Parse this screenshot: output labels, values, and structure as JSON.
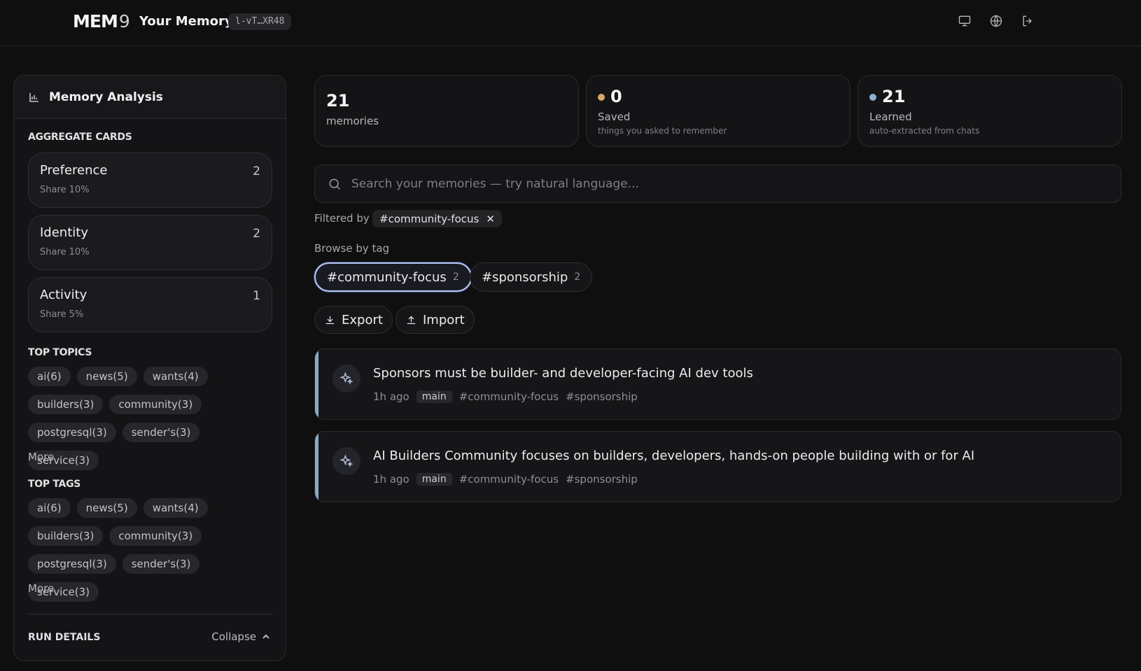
{
  "header": {
    "brand": "MEM",
    "brand_suffix": "9",
    "title": "Your Memory",
    "key": "l-vT…XR48",
    "icons": [
      "monitor-icon",
      "globe-icon",
      "logout-icon"
    ]
  },
  "sidebar": {
    "title": "Memory Analysis",
    "aggregate_label": "AGGREGATE CARDS",
    "aggregate_cards": [
      {
        "name": "Preference",
        "count": "2",
        "share": "Share 10%"
      },
      {
        "name": "Identity",
        "count": "2",
        "share": "Share 10%"
      },
      {
        "name": "Activity",
        "count": "1",
        "share": "Share 5%"
      }
    ],
    "topics_label": "TOP TOPICS",
    "topics": [
      "ai(6)",
      "news(5)",
      "wants(4)",
      "builders(3)",
      "community(3)",
      "postgresql(3)",
      "sender's(3)",
      "service(3)"
    ],
    "topics_more": "More",
    "tags_label": "TOP TAGS",
    "tags": [
      "ai(6)",
      "news(5)",
      "wants(4)",
      "builders(3)",
      "community(3)",
      "postgresql(3)",
      "sender's(3)",
      "service(3)"
    ],
    "tags_more": "More",
    "run_details_label": "RUN DETAILS",
    "collapse_label": "Collapse"
  },
  "stats": [
    {
      "num": "21",
      "label": "memories",
      "sub": ""
    },
    {
      "num": "0",
      "label": "Saved",
      "sub": "things you asked to remember",
      "dot_color": "#d9a66b"
    },
    {
      "num": "21",
      "label": "Learned",
      "sub": "auto-extracted from chats",
      "dot_color": "#8fb0cf"
    }
  ],
  "search": {
    "placeholder": "Search your memories — try natural language..."
  },
  "filter": {
    "label": "Filtered by",
    "active": "#community-focus",
    "clear": "✕"
  },
  "browse": {
    "label": "Browse by tag",
    "tags": [
      {
        "name": "#community-focus",
        "count": "2"
      },
      {
        "name": "#sponsorship",
        "count": "2"
      }
    ]
  },
  "actions": {
    "export": "Export",
    "import": "Import"
  },
  "memories": [
    {
      "text": "Sponsors must be builder- and developer-facing AI dev tools",
      "time": "1h ago",
      "branch": "main",
      "tags": [
        "#community-focus",
        "#sponsorship"
      ]
    },
    {
      "text": "AI Builders Community focuses on builders, developers, hands-on people building with or for AI",
      "time": "1h ago",
      "branch": "main",
      "tags": [
        "#community-focus",
        "#sponsorship"
      ]
    }
  ],
  "colors": {
    "accent_bar": "#8aa9c4",
    "active_tag_border": "#b9c6ee"
  }
}
